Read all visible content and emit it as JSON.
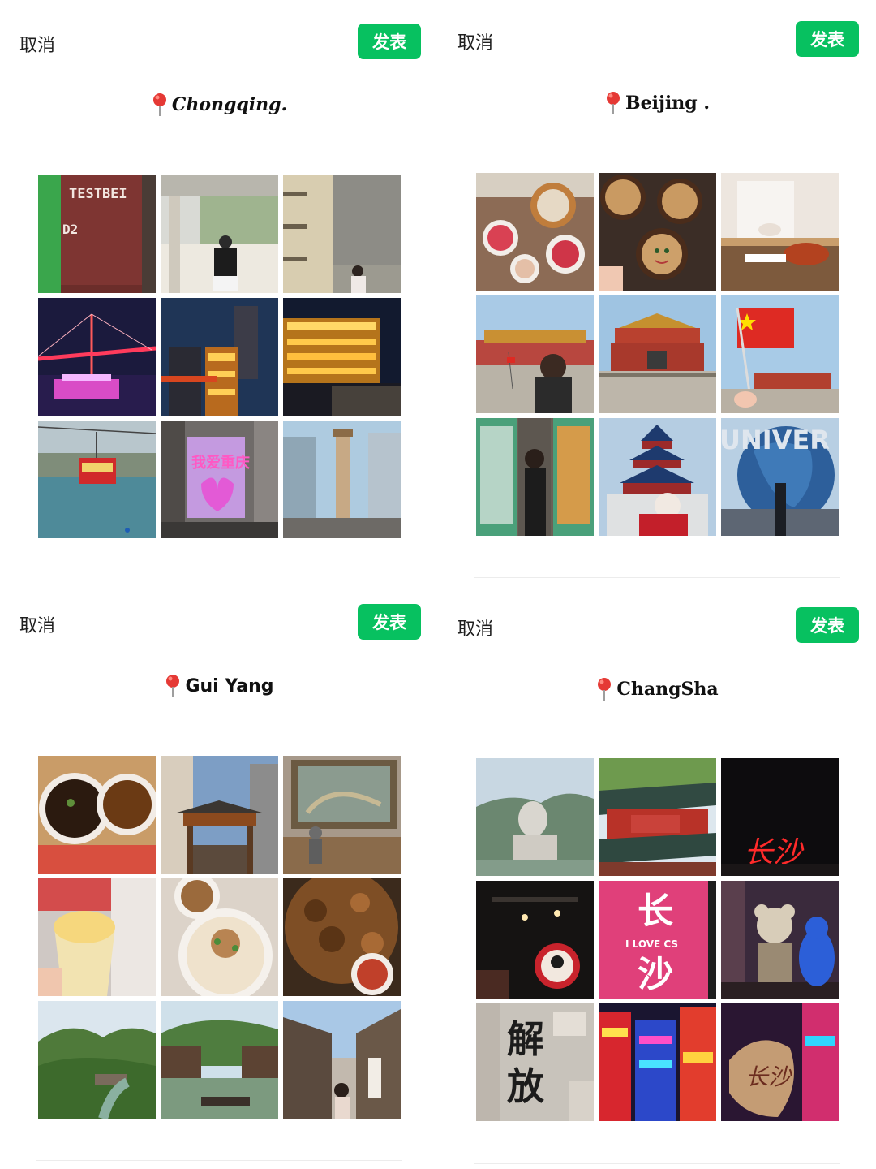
{
  "panels": [
    {
      "cancel_label": "取消",
      "publish_label": "发表",
      "location": "Chongqing.",
      "photos": [
        {
          "icon": "factory-door-photo",
          "text": "TESTBEI"
        },
        {
          "icon": "pavilion-photo"
        },
        {
          "icon": "old-wall-photo"
        },
        {
          "icon": "night-bridge-photo"
        },
        {
          "icon": "night-tower-photo"
        },
        {
          "icon": "hongyadong-night-photo"
        },
        {
          "icon": "cable-car-photo"
        },
        {
          "icon": "billboard-photo"
        },
        {
          "icon": "skyscraper-photo"
        }
      ]
    },
    {
      "cancel_label": "取消",
      "publish_label": "发表",
      "location": "Beijing .",
      "photos": [
        {
          "icon": "hotpot-photo"
        },
        {
          "icon": "sesame-bowls-photo"
        },
        {
          "icon": "roast-duck-photo"
        },
        {
          "icon": "tiananmen-girl-photo"
        },
        {
          "icon": "tiananmen-photo"
        },
        {
          "icon": "flag-photo"
        },
        {
          "icon": "shop-window-photo"
        },
        {
          "icon": "temple-of-heaven-photo"
        },
        {
          "icon": "universal-globe-photo",
          "text": "UNIVER"
        }
      ]
    },
    {
      "cancel_label": "取消",
      "publish_label": "发表",
      "location": "Gui Yang",
      "photos": [
        {
          "icon": "noodle-bowls-photo"
        },
        {
          "icon": "old-street-gate-photo"
        },
        {
          "icon": "sculpture-photo"
        },
        {
          "icon": "ice-cream-photo"
        },
        {
          "icon": "rice-noodle-photo"
        },
        {
          "icon": "fried-meat-photo"
        },
        {
          "icon": "green-hills-photo"
        },
        {
          "icon": "river-town-photo"
        },
        {
          "icon": "wooden-street-photo"
        }
      ]
    },
    {
      "cancel_label": "取消",
      "publish_label": "发表",
      "location": "ChangSha",
      "photos": [
        {
          "icon": "mao-statue-photo"
        },
        {
          "icon": "pavilion-roof-photo"
        },
        {
          "icon": "neon-sign-photo"
        },
        {
          "icon": "tea-shop-photo"
        },
        {
          "icon": "i-love-cs-photo",
          "text": "长",
          "text2": "I LOVE CS",
          "text3": "沙"
        },
        {
          "icon": "kaws-photo"
        },
        {
          "icon": "calligraphy-wall-photo"
        },
        {
          "icon": "neon-street-photo"
        },
        {
          "icon": "lantern-photo"
        }
      ]
    }
  ],
  "colors": {
    "publish": "#07c160",
    "pin": "#e53935"
  }
}
